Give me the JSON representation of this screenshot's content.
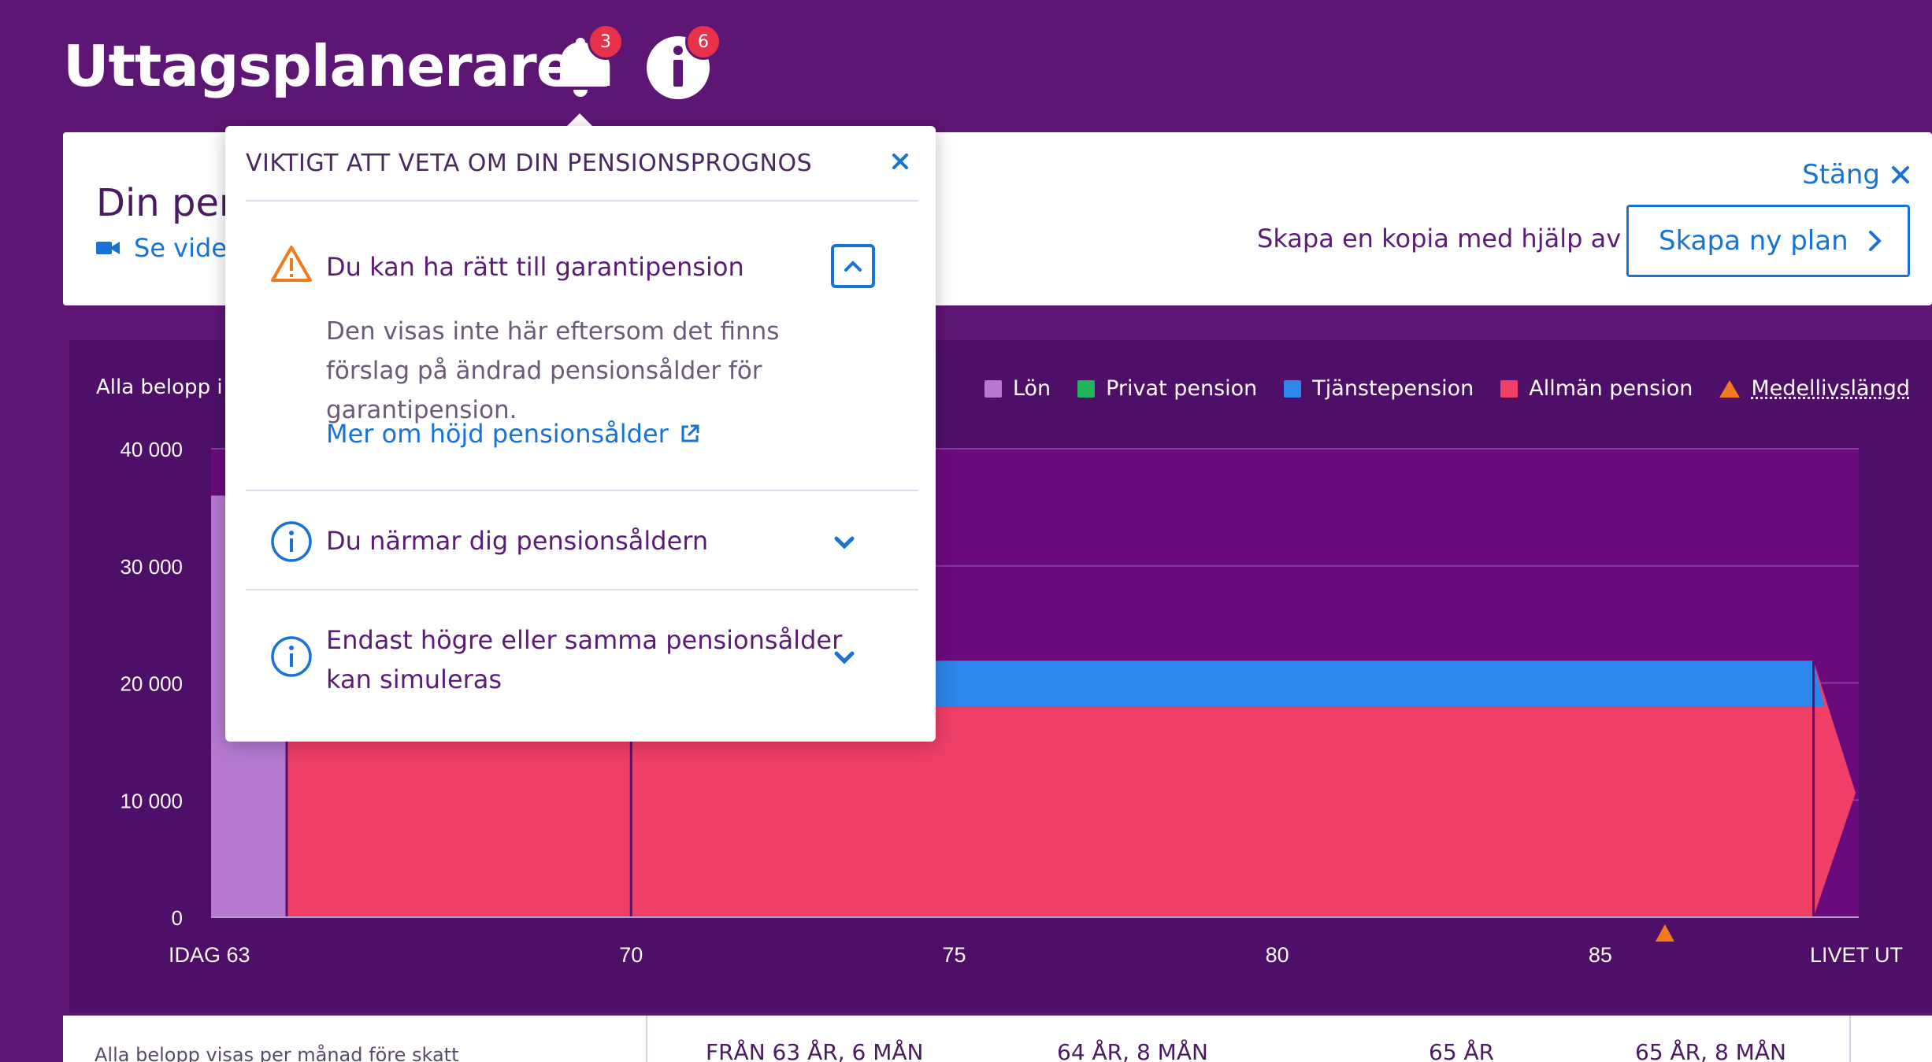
{
  "app": {
    "title": "Uttagsplaneraren"
  },
  "notifications": {
    "bell_count": "3",
    "info_count": "6"
  },
  "card": {
    "title_visible": "Din pen",
    "video_link": "Se video",
    "close_label": "Stäng",
    "copy_text": "Skapa en kopia med hjälp av",
    "new_plan_label": "Skapa ny plan"
  },
  "chart_panel": {
    "amount_note": "Alla belopp i U",
    "legend": [
      {
        "label": "Lön",
        "color": "#b57ad0"
      },
      {
        "label": "Privat pension",
        "color": "#22b45a"
      },
      {
        "label": "Tjänstepension",
        "color": "#2d86ea"
      },
      {
        "label": "Allmän pension",
        "color": "#ef3f66"
      },
      {
        "label": "Medellivslängd",
        "color": "#f07a1d"
      }
    ]
  },
  "chart_data": {
    "type": "area",
    "title": "",
    "xlabel": "",
    "ylabel": "",
    "ylim": [
      0,
      40000
    ],
    "y_ticks": [
      "40 000",
      "30 000",
      "20 000",
      "10 000",
      "0"
    ],
    "y_tick_values": [
      40000,
      30000,
      20000,
      10000,
      0
    ],
    "x_ticks": [
      "IDAG 63",
      "70",
      "75",
      "80",
      "85",
      "LIVET UT"
    ],
    "x_tick_values": [
      63.5,
      70,
      75,
      80,
      85,
      89
    ],
    "xlim": [
      63.5,
      89
    ],
    "life_expectancy_age": 86,
    "series": [
      {
        "name": "Lön",
        "color": "#b57ad0",
        "segments": [
          {
            "from": 63.5,
            "to": 64.67,
            "value": 36000
          }
        ]
      },
      {
        "name": "Allmän pension",
        "color": "#ef3f66",
        "segments": [
          {
            "from": 64.67,
            "to": 88.3,
            "value": 18000
          }
        ]
      },
      {
        "name": "Tjänstepension",
        "color": "#2d86ea",
        "segments": [
          {
            "from": 70,
            "to": 88.3,
            "value": 3900
          }
        ]
      }
    ]
  },
  "bottom_table": {
    "columns": [
      "FRÅN 63 ÅR, 6 MÅN",
      "64 ÅR, 8 MÅN",
      "65 ÅR",
      "65 ÅR, 8 MÅN"
    ],
    "left_text": "Alla belopp visas per månad före skatt"
  },
  "popover": {
    "heading": "VIKTIGT ATT VETA OM DIN PENSIONSPROGNOS",
    "items": [
      {
        "title": "Du kan ha rätt till garantipension",
        "body": "Den visas inte här eftersom det finns förslag på ändrad pensionsålder för garantipension.",
        "link": "Mer om höjd pensionsålder"
      },
      {
        "title": "Du närmar dig pensionsåldern"
      },
      {
        "title": "Endast högre eller samma pensionsålder kan simuleras"
      }
    ]
  }
}
